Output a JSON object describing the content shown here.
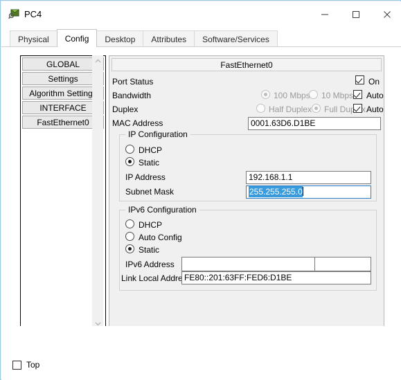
{
  "window": {
    "title": "PC4",
    "icon": "pc-device-icon",
    "controls": {
      "minimize": "minimize-icon",
      "maximize": "maximize-icon",
      "close": "close-icon"
    }
  },
  "tabs": [
    {
      "label": "Physical",
      "active": false
    },
    {
      "label": "Config",
      "active": true
    },
    {
      "label": "Desktop",
      "active": false
    },
    {
      "label": "Attributes",
      "active": false
    },
    {
      "label": "Software/Services",
      "active": false
    }
  ],
  "sidebar": {
    "items": [
      {
        "label": "GLOBAL"
      },
      {
        "label": "Settings"
      },
      {
        "label": "Algorithm Settings"
      },
      {
        "label": "INTERFACE"
      },
      {
        "label": "FastEthernet0"
      }
    ],
    "scrollbar": {
      "up_arrow": "chevron-up-icon",
      "down_arrow": "chevron-down-icon"
    }
  },
  "panel": {
    "header": "FastEthernet0",
    "port_status": {
      "label": "Port Status",
      "checkbox_label": "On",
      "checked": true
    },
    "bandwidth": {
      "label": "Bandwidth",
      "option_100": "100 Mbps",
      "option_10": "10 Mbps",
      "selected": "100 Mbps",
      "auto_label": "Auto",
      "auto_checked": true,
      "enabled": false
    },
    "duplex": {
      "label": "Duplex",
      "option_half": "Half Duplex",
      "option_full": "Full Duplex",
      "selected": "Full Duplex",
      "auto_label": "Auto",
      "auto_checked": true,
      "enabled": false
    },
    "mac": {
      "label": "MAC Address",
      "value": "0001.63D6.D1BE"
    },
    "ip_configuration": {
      "title": "IP Configuration",
      "dhcp_label": "DHCP",
      "static_label": "Static",
      "selected": "Static",
      "ip_address_label": "IP Address",
      "ip_address_value": "192.168.1.1",
      "subnet_mask_label": "Subnet Mask",
      "subnet_mask_value": "255.255.255.0",
      "subnet_mask_selected": true
    },
    "ipv6_configuration": {
      "title": "IPv6 Configuration",
      "dhcp_label": "DHCP",
      "auto_config_label": "Auto Config",
      "static_label": "Static",
      "selected": "Static",
      "ipv6_address_label": "IPv6 Address",
      "ipv6_address_value": "",
      "prefix_separator": "/",
      "ipv6_prefix_value": "",
      "link_local_label": "Link Local Address:",
      "link_local_value": "FE80::201:63FF:FED6:D1BE"
    }
  },
  "footer": {
    "top_checkbox_label": "Top",
    "top_checked": false
  },
  "colors": {
    "window_border": "#9ccbe8",
    "selection": "#3a9bdc",
    "panel_bg": "#f0f0f0",
    "disabled_text": "#9a9a9a"
  }
}
